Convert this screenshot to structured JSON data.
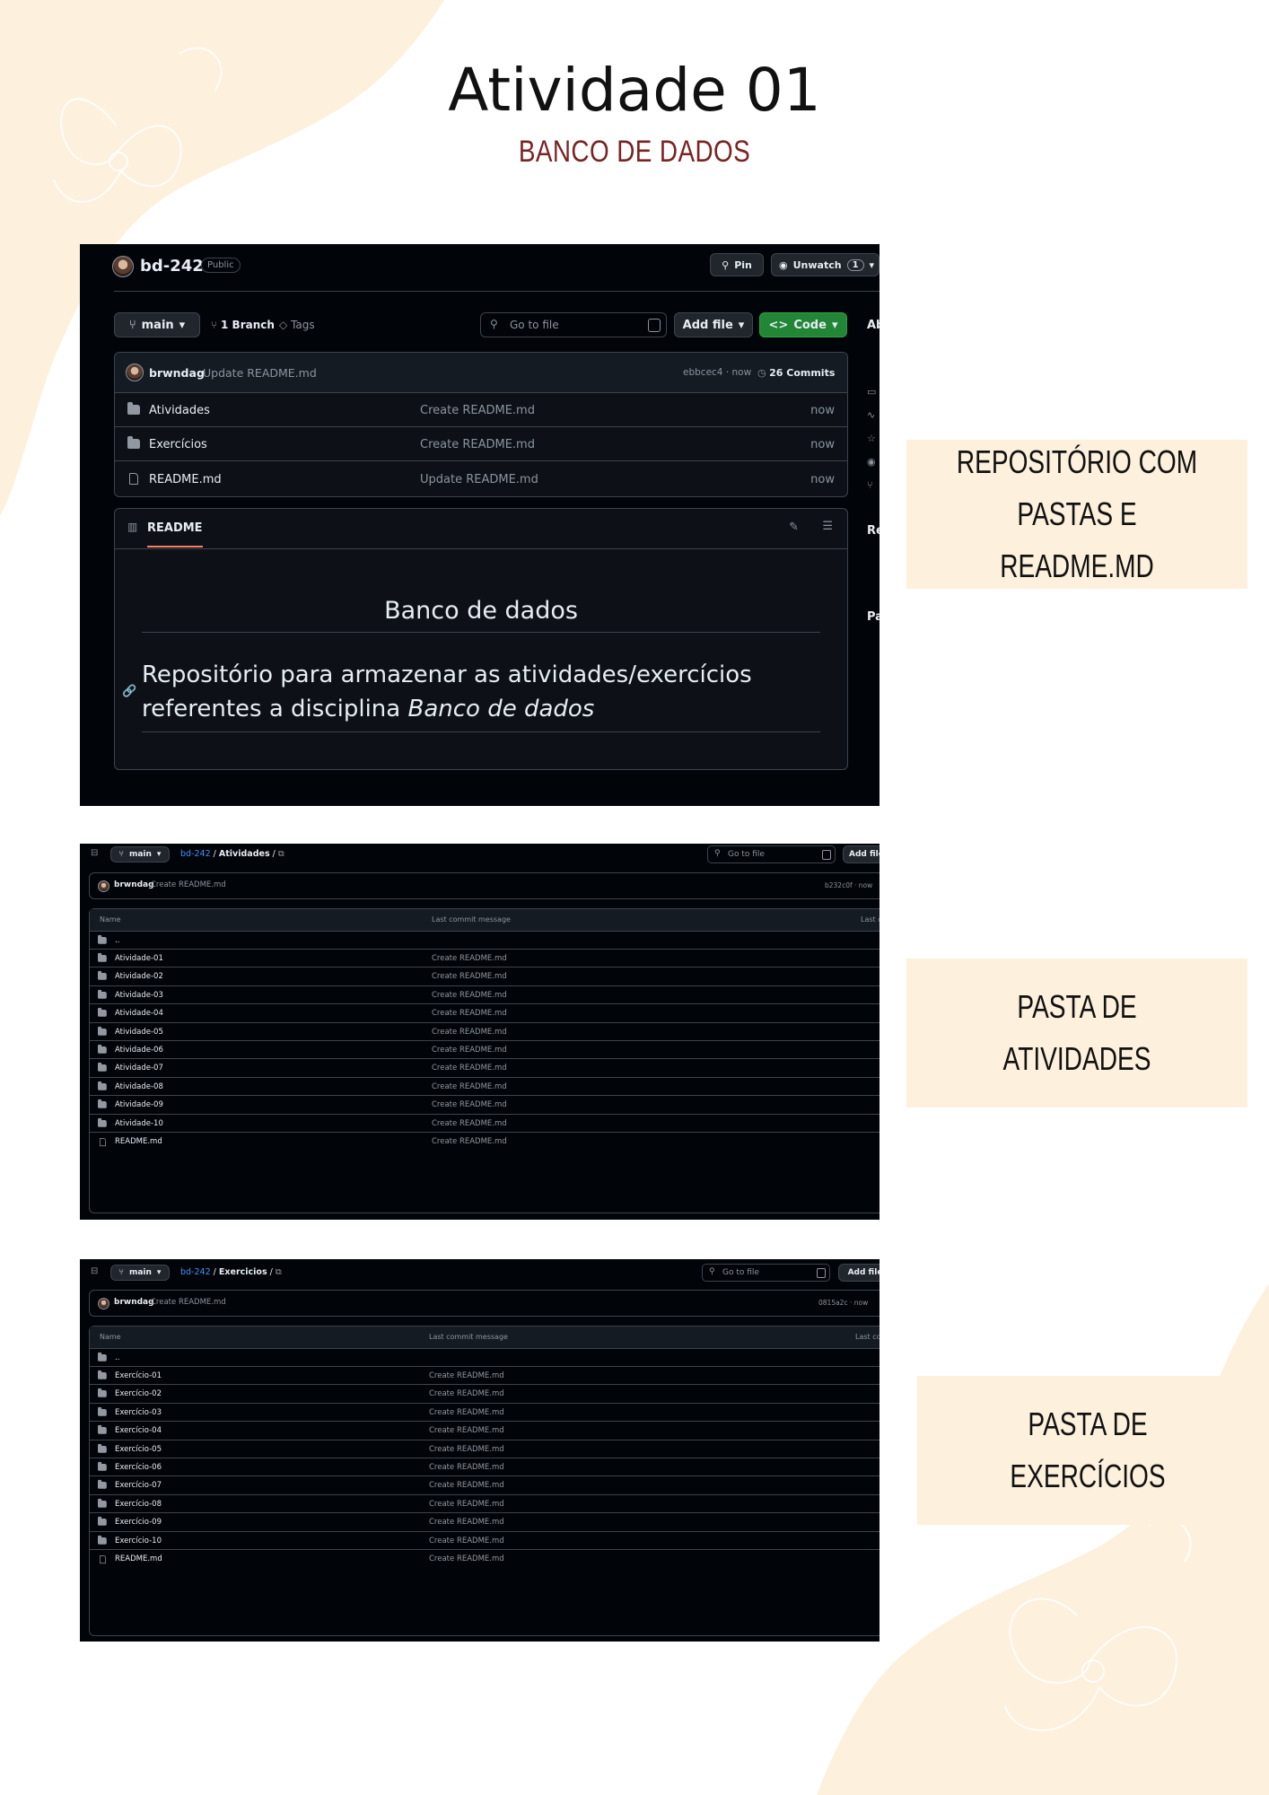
{
  "page": {
    "title": "Atividade 01",
    "subtitle": "BANCO DE DADOS",
    "labels": {
      "repo": "REPOSITÓRIO COM PASTAS E README.MD",
      "atividades": "PASTA DE ATIVIDADES",
      "exercicios": "PASTA DE EXERCÍCIOS"
    }
  },
  "repo": {
    "name": "bd-242",
    "visibility": "Public",
    "pin_label": "Pin",
    "unwatch_label": "Unwatch",
    "watch_count": "1",
    "branch": "main",
    "branch_count": "1 Branch",
    "tags_label": "Tags",
    "search_placeholder": "Go to file",
    "add_file_label": "Add file",
    "code_label": "Code",
    "sidebar_about": "Ab",
    "sidebar_releases": "Re",
    "sidebar_packages": "Pa",
    "last_commit": {
      "author": "brwndag",
      "message": "Update README.md",
      "hash": "ebbcec4 · now",
      "commits": "26 Commits"
    },
    "files": [
      {
        "name": "Atividades",
        "message": "Create README.md",
        "time": "now",
        "type": "folder"
      },
      {
        "name": "Exercícios",
        "message": "Create README.md",
        "time": "now",
        "type": "folder"
      },
      {
        "name": "README.md",
        "message": "Update README.md",
        "time": "now",
        "type": "file"
      }
    ],
    "readme": {
      "tab_label": "README",
      "heading": "Banco de dados",
      "body_prefix": "Repositório para armazenar as atividades/exercícios referentes a disciplina ",
      "body_italic": "Banco de dados"
    }
  },
  "atividades": {
    "branch": "main",
    "repo_link": "bd-242",
    "sep": "/",
    "folder": "Atividades",
    "trail": "/",
    "search_placeholder": "Go to file",
    "add_file_label": "Add file",
    "commit_author": "brwndag",
    "commit_message": "Create README.md",
    "commit_hash": "b232c0f · now",
    "col_name": "Name",
    "col_message": "Last commit message",
    "col_date": "Last co",
    "parent": "..",
    "items": [
      {
        "name": "Atividade-01",
        "message": "Create README.md"
      },
      {
        "name": "Atividade-02",
        "message": "Create README.md"
      },
      {
        "name": "Atividade-03",
        "message": "Create README.md"
      },
      {
        "name": "Atividade-04",
        "message": "Create README.md"
      },
      {
        "name": "Atividade-05",
        "message": "Create README.md"
      },
      {
        "name": "Atividade-06",
        "message": "Create README.md"
      },
      {
        "name": "Atividade-07",
        "message": "Create README.md"
      },
      {
        "name": "Atividade-08",
        "message": "Create README.md"
      },
      {
        "name": "Atividade-09",
        "message": "Create README.md"
      },
      {
        "name": "Atividade-10",
        "message": "Create README.md"
      },
      {
        "name": "README.md",
        "message": "Create README.md"
      }
    ]
  },
  "exercicios": {
    "branch": "main",
    "repo_link": "bd-242",
    "sep": "/",
    "folder": "Exercicios",
    "trail": "/",
    "search_placeholder": "Go to file",
    "add_file_label": "Add file",
    "commit_author": "brwndag",
    "commit_message": "Create README.md",
    "commit_hash": "0815a2c · now",
    "col_name": "Name",
    "col_message": "Last commit message",
    "col_date": "Last comr",
    "parent": "..",
    "items": [
      {
        "name": "Exercício-01",
        "message": "Create README.md"
      },
      {
        "name": "Exercício-02",
        "message": "Create README.md"
      },
      {
        "name": "Exercício-03",
        "message": "Create README.md"
      },
      {
        "name": "Exercício-04",
        "message": "Create README.md"
      },
      {
        "name": "Exercício-05",
        "message": "Create README.md"
      },
      {
        "name": "Exercício-06",
        "message": "Create README.md"
      },
      {
        "name": "Exercício-07",
        "message": "Create README.md"
      },
      {
        "name": "Exercício-08",
        "message": "Create README.md"
      },
      {
        "name": "Exercício-09",
        "message": "Create README.md"
      },
      {
        "name": "Exercício-10",
        "message": "Create README.md"
      },
      {
        "name": "README.md",
        "message": "Create README.md"
      }
    ]
  },
  "colors": {
    "background_shape": "#fdf0dc",
    "label_box": "#fdf0dc",
    "subtitle": "#7a2323",
    "github_bg": "#010409",
    "github_green": "#238636",
    "github_link": "#4493f8"
  }
}
